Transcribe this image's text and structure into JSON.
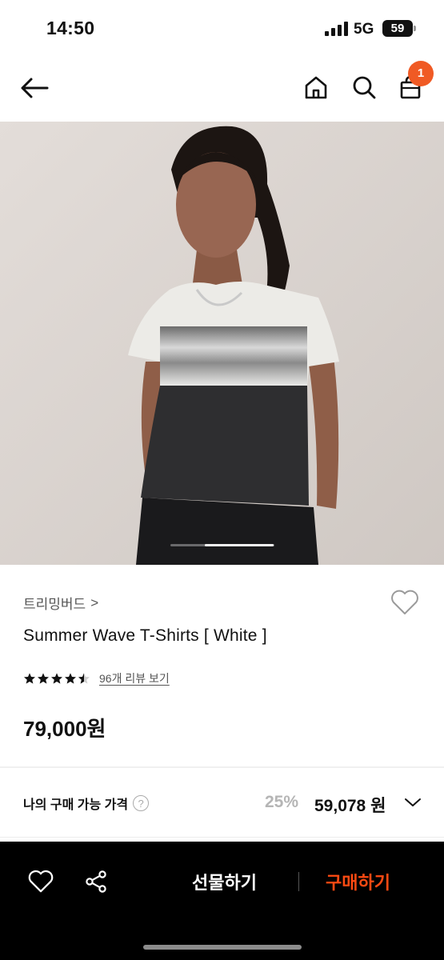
{
  "status_bar": {
    "time": "14:50",
    "network": "5G",
    "battery": "59"
  },
  "header": {
    "back_icon": "arrow-left-icon",
    "home_icon": "home-icon",
    "search_icon": "search-icon",
    "cart_icon": "shopping-bag-icon",
    "cart_count": "1",
    "badge_color": "#f05a24"
  },
  "product": {
    "image_icon": "product-photo",
    "brand": "트리밍버드",
    "brand_chevron": ">",
    "title": "Summer Wave T-Shirts [ White ]",
    "rating_stars": 4.5,
    "review_link": "96개 리뷰 보기",
    "price": "79,000원",
    "my_price_label": "나의 구매 가능 가격",
    "help_glyph": "?",
    "discount": "25%",
    "my_price": "59,078 원"
  },
  "bottom_bar": {
    "gift_label": "선물하기",
    "buy_label": "구매하기",
    "buy_color": "#ff4a12"
  }
}
